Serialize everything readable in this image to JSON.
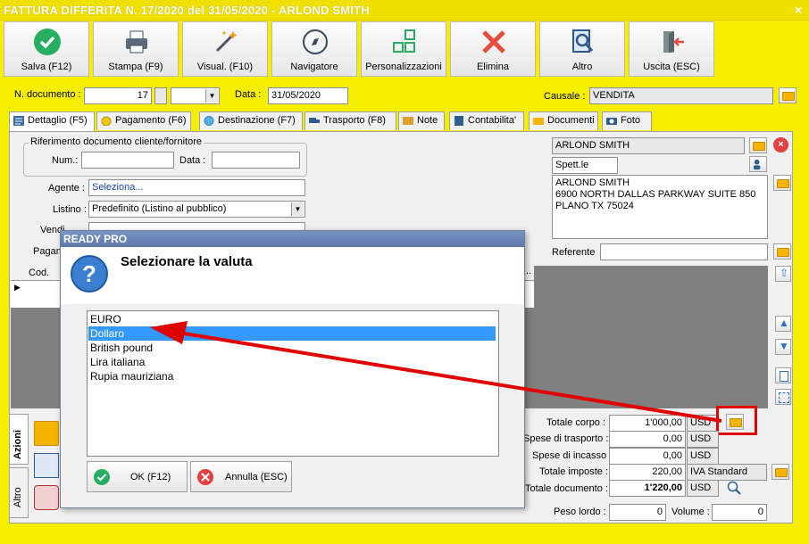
{
  "window": {
    "title": "FATTURA DIFFERITA N. 17/2020 del 31/05/2020 - ARLOND SMITH",
    "close": "×"
  },
  "toolbar": [
    {
      "label": "Salva (F12)",
      "icon": "save-check-icon"
    },
    {
      "label": "Stampa (F9)",
      "icon": "printer-icon"
    },
    {
      "label": "Visual. (F10)",
      "icon": "magic-wand-icon"
    },
    {
      "label": "Navigatore",
      "icon": "compass-icon"
    },
    {
      "label": "Personalizzazioni",
      "icon": "layout-blocks-icon"
    },
    {
      "label": "Elimina",
      "icon": "delete-x-icon"
    },
    {
      "label": "Altro",
      "icon": "search-doc-icon"
    },
    {
      "label": "Uscita (ESC)",
      "icon": "exit-door-icon"
    }
  ],
  "header": {
    "num_label": "N. documento :",
    "num_value": "17",
    "date_label": "Data :",
    "date_value": "31/05/2020",
    "causale_label": "Causale :",
    "causale_value": "VENDITA"
  },
  "tabs": [
    "Dettaglio (F5)",
    "Pagamento (F6)",
    "Destinazione (F7)",
    "Trasporto (F8)",
    "Note",
    "Contabilita'",
    "Documenti",
    "Foto"
  ],
  "form": {
    "rif_legend": "Riferimento documento cliente/fornitore",
    "num_label": "Num.:",
    "data_label": "Data :",
    "agente_label": "Agente :",
    "agente_value": "Seleziona...",
    "listino_label": "Listino :",
    "listino_value": "Predefinito (Listino al pubblico)",
    "vendi_label": "Vendi",
    "pagam_label": "Pagam"
  },
  "customer": {
    "name": "ARLOND SMITH",
    "salutation": "Spett.le",
    "address": [
      "ARLOND SMITH",
      "6900 NORTH DALLAS PARKWAY SUITE 850",
      "PLANO TX 75024"
    ],
    "referente_label": "Referente"
  },
  "grid": {
    "col_cod": "Cod.",
    "col_more": "..."
  },
  "side_tabs": {
    "azioni": "Azioni",
    "altro": "Altro"
  },
  "totals": {
    "totale_corpo_label": "Totale corpo :",
    "totale_corpo": "1'000,00",
    "totale_corpo_cur": "USD",
    "spese_trasporto_label": "Spese di trasporto :",
    "spese_trasporto": "0,00",
    "spese_trasporto_cur": "USD",
    "spese_incasso_label": "Spese di incasso :",
    "spese_incasso": "0,00",
    "spese_incasso_cur": "USD",
    "totale_imposte_label": "Totale imposte :",
    "totale_imposte": "220,00",
    "iva": "IVA Standard",
    "totale_documento_label": "Totale documento :",
    "totale_documento": "1'220,00",
    "totale_documento_cur": "USD",
    "peso_label": "Peso lordo :",
    "peso": "0",
    "volume_label": "Volume :",
    "volume": "0"
  },
  "dialog": {
    "title": "READY PRO",
    "message": "Selezionare la valuta",
    "options": [
      "EURO",
      "Dollaro",
      "British pound",
      "Lira italiana",
      "Rupia mauriziana"
    ],
    "selected_index": 1,
    "ok_label": "OK (F12)",
    "cancel_label": "Annulla (ESC)"
  },
  "colors": {
    "background": "#f5ee00",
    "selection": "#3399ff",
    "annotation": "#e00000"
  }
}
